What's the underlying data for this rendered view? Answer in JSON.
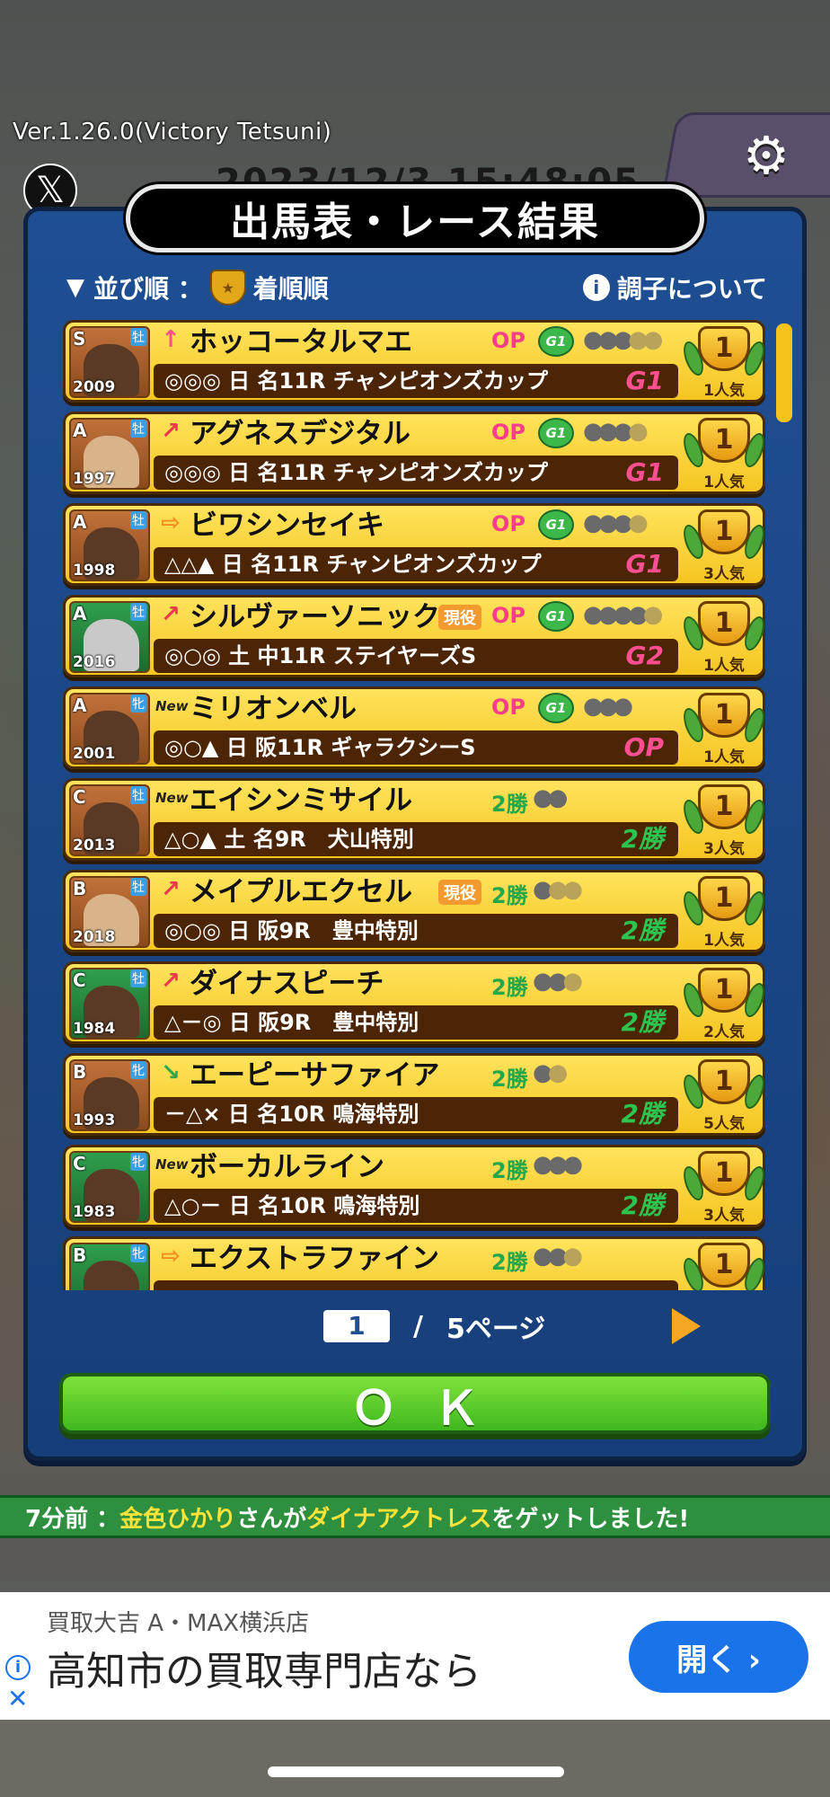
{
  "version": "Ver.1.26.0(Victory Tetsuni)",
  "date_peek": "2023/12/3 15:48:05",
  "title": "出馬表・レース結果",
  "sort": {
    "prefix": "並び順 ：",
    "value": "着順順",
    "condition_link": "調子について"
  },
  "rows": [
    {
      "rank": "S",
      "year": "2009",
      "sex": "牡",
      "trend": "↑",
      "trend_kind": "up",
      "new": "",
      "name": "ホッコータルマエ",
      "genyaku": "",
      "cls": "OP",
      "cls_kind": "op",
      "g1": true,
      "shoes_on": 3,
      "shoes_off": 2,
      "result": "◎◎◎ 日 名11R チャンピオンズカップ",
      "grade": "G1",
      "grade_kind": "pink",
      "place": "1",
      "pop": "1人気",
      "portrait": "b",
      "horse": "dark"
    },
    {
      "rank": "A",
      "year": "1997",
      "sex": "牡",
      "trend": "↗",
      "trend_kind": "diag",
      "new": "",
      "name": "アグネスデジタル",
      "genyaku": "",
      "cls": "OP",
      "cls_kind": "op",
      "g1": true,
      "shoes_on": 3,
      "shoes_off": 1,
      "result": "◎◎◎ 日 名11R チャンピオンズカップ",
      "grade": "G1",
      "grade_kind": "pink",
      "place": "1",
      "pop": "1人気",
      "portrait": "b",
      "horse": ""
    },
    {
      "rank": "A",
      "year": "1998",
      "sex": "牡",
      "trend": "⇨",
      "trend_kind": "flat",
      "new": "",
      "name": "ビワシンセイキ",
      "genyaku": "",
      "cls": "OP",
      "cls_kind": "op",
      "g1": true,
      "shoes_on": 3,
      "shoes_off": 1,
      "result": "△△▲ 日 名11R チャンピオンズカップ",
      "grade": "G1",
      "grade_kind": "pink",
      "place": "1",
      "pop": "3人気",
      "portrait": "b",
      "horse": "dark"
    },
    {
      "rank": "A",
      "year": "2016",
      "sex": "牡",
      "trend": "↗",
      "trend_kind": "diag",
      "new": "",
      "name": "シルヴァーソニック",
      "genyaku": "現役",
      "cls": "OP",
      "cls_kind": "op",
      "g1": true,
      "shoes_on": 4,
      "shoes_off": 1,
      "result": "◎○◎ 土 中11R ステイヤーズS",
      "grade": "G2",
      "grade_kind": "pink",
      "place": "1",
      "pop": "1人気",
      "portrait": "g",
      "horse": "grey"
    },
    {
      "rank": "A",
      "year": "2001",
      "sex": "牝",
      "trend": "",
      "trend_kind": "up",
      "new": "New",
      "name": "ミリオンベル",
      "genyaku": "",
      "cls": "OP",
      "cls_kind": "op",
      "g1": true,
      "shoes_on": 3,
      "shoes_off": 0,
      "result": "◎○▲ 日 阪11R ギャラクシーS",
      "grade": "OP",
      "grade_kind": "pink",
      "place": "1",
      "pop": "1人気",
      "portrait": "b",
      "horse": "dark"
    },
    {
      "rank": "C",
      "year": "2013",
      "sex": "牡",
      "trend": "",
      "trend_kind": "up",
      "new": "New",
      "name": "エイシンミサイル",
      "genyaku": "",
      "cls": "2勝",
      "cls_kind": "win",
      "g1": false,
      "shoes_on": 2,
      "shoes_off": 0,
      "result": "△○▲ 土 名9R　犬山特別",
      "grade": "2勝",
      "grade_kind": "green",
      "place": "1",
      "pop": "3人気",
      "portrait": "b",
      "horse": "dark"
    },
    {
      "rank": "B",
      "year": "2018",
      "sex": "牡",
      "trend": "↗",
      "trend_kind": "diag",
      "new": "",
      "name": "メイプルエクセル",
      "genyaku": "現役",
      "cls": "2勝",
      "cls_kind": "win",
      "g1": false,
      "shoes_on": 1,
      "shoes_off": 2,
      "result": "◎○◎ 日 阪9R　豊中特別",
      "grade": "2勝",
      "grade_kind": "green",
      "place": "1",
      "pop": "1人気",
      "portrait": "b",
      "horse": ""
    },
    {
      "rank": "C",
      "year": "1984",
      "sex": "牡",
      "trend": "↗",
      "trend_kind": "diag",
      "new": "",
      "name": "ダイナスピーチ",
      "genyaku": "",
      "cls": "2勝",
      "cls_kind": "win",
      "g1": false,
      "shoes_on": 2,
      "shoes_off": 1,
      "result": "△－◎ 日 阪9R　豊中特別",
      "grade": "2勝",
      "grade_kind": "green",
      "place": "1",
      "pop": "2人気",
      "portrait": "g",
      "horse": "dark"
    },
    {
      "rank": "B",
      "year": "1993",
      "sex": "牝",
      "trend": "↘",
      "trend_kind": "down",
      "new": "",
      "name": "エーピーサファイア",
      "genyaku": "",
      "cls": "2勝",
      "cls_kind": "win",
      "g1": false,
      "shoes_on": 1,
      "shoes_off": 1,
      "result": "－△× 日 名10R 鳴海特別",
      "grade": "2勝",
      "grade_kind": "green",
      "place": "1",
      "pop": "5人気",
      "portrait": "b",
      "horse": "dark"
    },
    {
      "rank": "C",
      "year": "1983",
      "sex": "牝",
      "trend": "",
      "trend_kind": "up",
      "new": "New",
      "name": "ボーカルライン",
      "genyaku": "",
      "cls": "2勝",
      "cls_kind": "win",
      "g1": false,
      "shoes_on": 3,
      "shoes_off": 0,
      "result": "△○－ 日 名10R 鳴海特別",
      "grade": "2勝",
      "grade_kind": "green",
      "place": "1",
      "pop": "3人気",
      "portrait": "g",
      "horse": "dark"
    },
    {
      "rank": "B",
      "year": "",
      "sex": "牝",
      "trend": "⇨",
      "trend_kind": "flat",
      "new": "",
      "name": "エクストラファイン",
      "genyaku": "",
      "cls": "2勝",
      "cls_kind": "win",
      "g1": false,
      "shoes_on": 2,
      "shoes_off": 1,
      "result": "",
      "grade": "",
      "grade_kind": "green",
      "place": "1",
      "pop": "",
      "portrait": "g",
      "horse": "dark"
    }
  ],
  "pager": {
    "current": "1",
    "slash": "/",
    "total": "5ページ"
  },
  "ok_label": "ＯＫ",
  "news": {
    "time": "7分前 ：",
    "user": "金色ひかり",
    "mid": "さんが",
    "item": "ダイナアクトレス",
    "tail": "をゲットしました!"
  },
  "ad": {
    "sub": "買取大吉 A・MAX横浜店",
    "main": "高知市の買取専門店なら",
    "open": "開く ›"
  },
  "colors": {
    "panel": "#1f4f93",
    "row": "#f5c521",
    "ok": "#4fcc24",
    "news": "#2e8f3e",
    "ad_button": "#1a73e8"
  }
}
